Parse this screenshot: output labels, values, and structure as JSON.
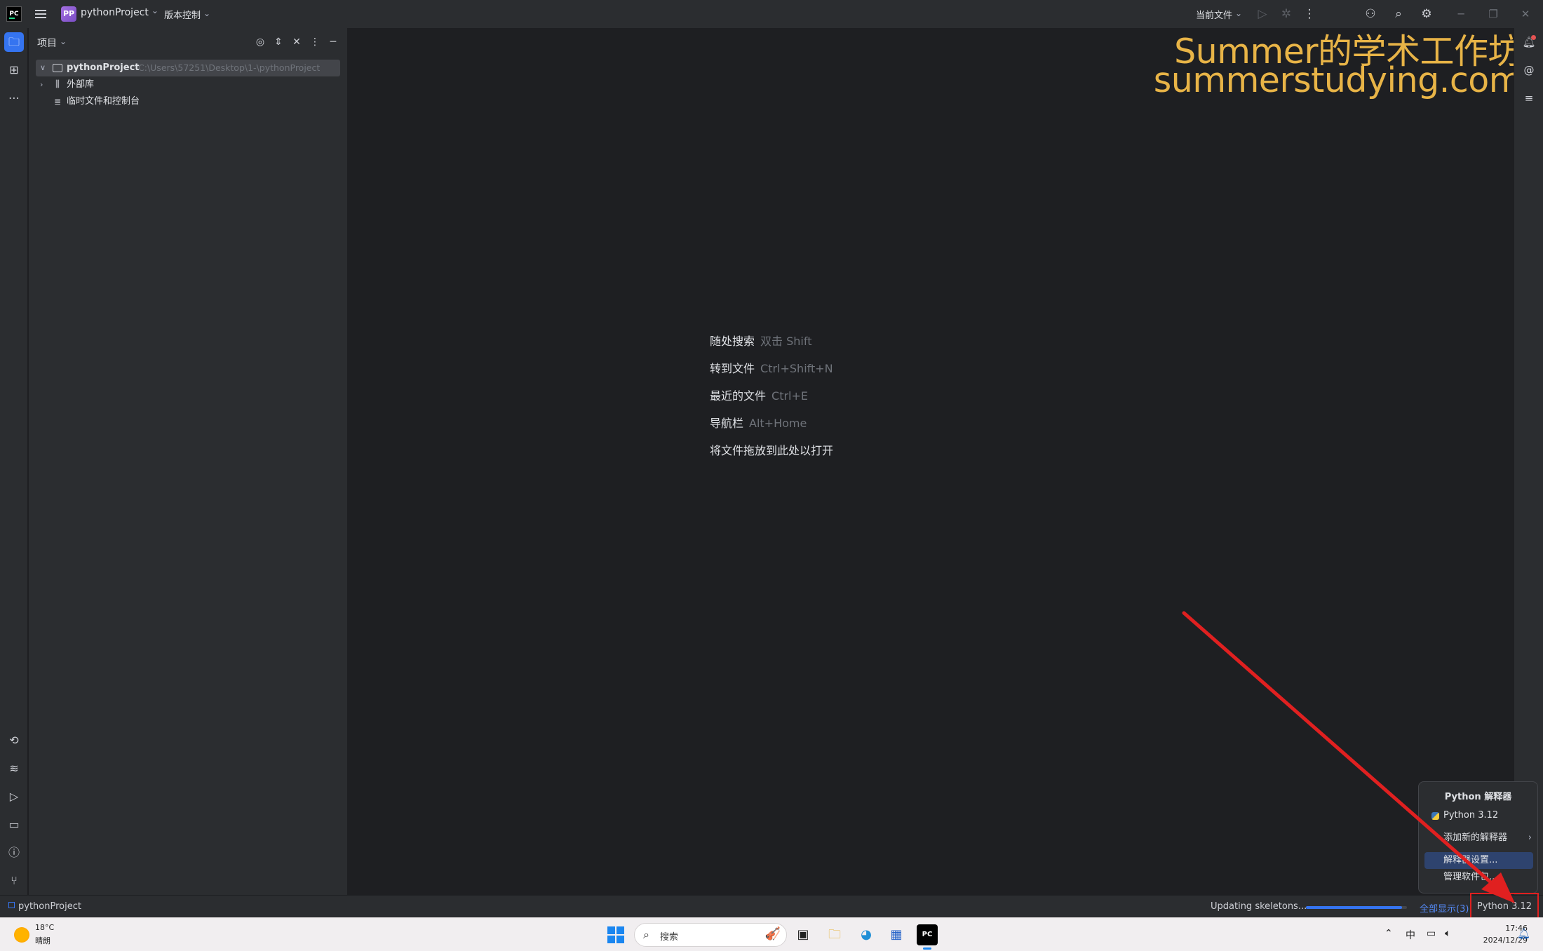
{
  "titlebar": {
    "project_badge": "PP",
    "project_name": "pythonProject",
    "vcs_label": "版本控制",
    "run_config": "当前文件"
  },
  "project_panel": {
    "header": "项目",
    "tree": [
      {
        "label": "pythonProject",
        "path": "C:\\Users\\57251\\Desktop\\1-\\pythonProject"
      },
      {
        "label": "外部库"
      },
      {
        "label": "临时文件和控制台"
      }
    ]
  },
  "editor": {
    "hints": [
      {
        "action": "随处搜索",
        "shortcut": "双击 Shift"
      },
      {
        "action": "转到文件",
        "shortcut": "Ctrl+Shift+N"
      },
      {
        "action": "最近的文件",
        "shortcut": "Ctrl+E"
      },
      {
        "action": "导航栏",
        "shortcut": "Alt+Home"
      },
      {
        "action": "将文件拖放到此处以打开",
        "shortcut": ""
      }
    ]
  },
  "watermark": {
    "line1": "Summer的学术工作坊",
    "line2": "summerstudying.com"
  },
  "popup": {
    "title": "Python 解释器",
    "items": [
      "Python 3.12",
      "添加新的解释器",
      "解释器设置...",
      "管理软件包..."
    ]
  },
  "statusbar": {
    "project": "pythonProject",
    "task": "Updating skeletons...",
    "progress": 0.95,
    "show_all": "全部显示(3)",
    "interpreter": "Python 3.12"
  },
  "taskbar": {
    "weather_temp": "18°C",
    "weather_desc": "晴朗",
    "search_placeholder": "搜索",
    "ime": "中",
    "time": "17:46",
    "date": "2024/12/29"
  },
  "colors": {
    "accent": "#3574f0",
    "watermark": "#e8b447",
    "highlight_red": "#e02020",
    "panel_bg": "#2b2d30",
    "editor_bg": "#1e1f22"
  },
  "icons": {
    "left_strip": [
      "folder-icon",
      "structure-icon",
      "more-icon",
      "python-console-icon",
      "python-packages-icon",
      "services-icon",
      "terminal-icon",
      "problems-icon",
      "git-icon"
    ],
    "right_strip": [
      "notifications-icon",
      "ai-assistant-icon",
      "database-icon"
    ]
  }
}
